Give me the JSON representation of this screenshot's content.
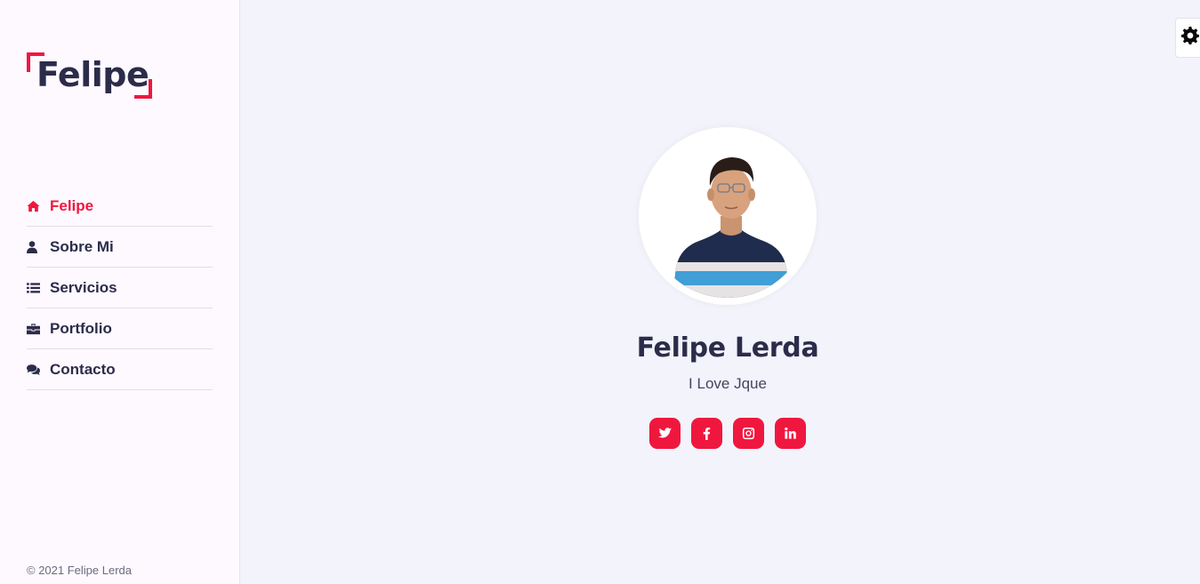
{
  "logo": {
    "text": "Felipe"
  },
  "nav": {
    "items": [
      {
        "label": "Felipe",
        "icon": "home-icon",
        "active": true
      },
      {
        "label": "Sobre Mi",
        "icon": "user-icon",
        "active": false
      },
      {
        "label": "Servicios",
        "icon": "list-icon",
        "active": false
      },
      {
        "label": "Portfolio",
        "icon": "briefcase-icon",
        "active": false
      },
      {
        "label": "Contacto",
        "icon": "comments-icon",
        "active": false
      }
    ]
  },
  "footer": {
    "copyright": "© 2021 Felipe Lerda"
  },
  "profile": {
    "name": "Felipe Lerda",
    "tagline": "I Love Jque",
    "socials": [
      "twitter-icon",
      "facebook-icon",
      "instagram-icon",
      "linkedin-icon"
    ]
  },
  "settings": {
    "icon": "gear-icon"
  },
  "colors": {
    "accent": "#f0173f",
    "text": "#2c2c4a",
    "sidebar_bg": "#fdf9ff",
    "main_bg": "#f2f3fb"
  }
}
